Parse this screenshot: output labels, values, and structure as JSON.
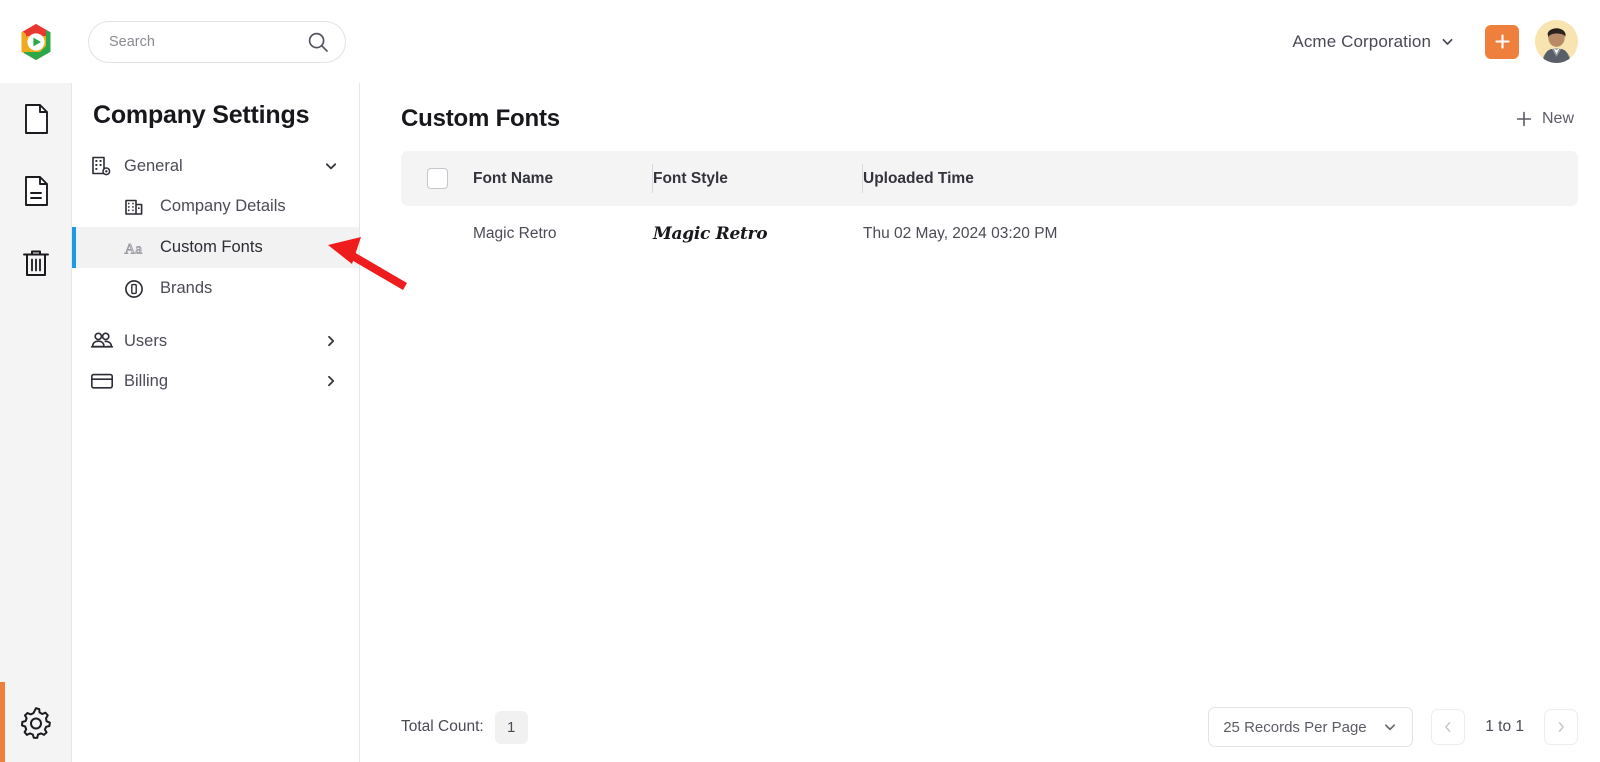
{
  "topbar": {
    "logo_icon": "hexagon-play-logo",
    "search": {
      "placeholder": "Search",
      "value": "",
      "icon": "search-icon"
    },
    "org_name": "Acme Corporation",
    "org_chevron_icon": "chevron-down-icon",
    "add_button_icon": "plus-icon",
    "avatar_icon": "user-avatar"
  },
  "rail": {
    "items": [
      {
        "icon": "file-blank-icon",
        "name": "file-blank"
      },
      {
        "icon": "file-lines-icon",
        "name": "file-lines"
      },
      {
        "icon": "trash-icon",
        "name": "trash"
      }
    ],
    "bottom": {
      "icon": "gear-icon",
      "name": "settings",
      "accent": "#ef7f3c"
    }
  },
  "sidebar": {
    "title": "Company Settings",
    "groups": [
      {
        "label": "General",
        "icon": "building-gear-icon",
        "chevron": "chevron-down-icon",
        "expanded": true,
        "children": [
          {
            "label": "Company Details",
            "icon": "building-icon",
            "active": false
          },
          {
            "label": "Custom Fonts",
            "icon": "font-aa-icon",
            "active": true
          },
          {
            "label": "Brands",
            "icon": "circle-b-icon",
            "active": false
          }
        ]
      },
      {
        "label": "Users",
        "icon": "users-icon",
        "chevron": "chevron-right-icon",
        "expanded": false,
        "children": []
      },
      {
        "label": "Billing",
        "icon": "credit-card-icon",
        "chevron": "chevron-right-icon",
        "expanded": false,
        "children": []
      }
    ],
    "active_indicator_color": "#1c9ae8"
  },
  "main": {
    "page_title": "Custom Fonts",
    "new_button": {
      "label": "New",
      "icon": "plus-icon"
    },
    "table": {
      "select_all_checked": false,
      "columns": [
        "Font Name",
        "Font Style",
        "Uploaded Time"
      ],
      "rows": [
        {
          "font_name": "Magic Retro",
          "font_style": "Magic Retro",
          "uploaded_time": "Thu 02 May, 2024 03:20 PM"
        }
      ]
    }
  },
  "footer": {
    "total_count_label": "Total Count:",
    "total_count_value": "1",
    "records_per_page": "25 Records Per Page",
    "records_chevron_icon": "chevron-down-icon",
    "prev_icon": "chevron-left-icon",
    "next_icon": "chevron-right-icon",
    "page_range": "1 to 1"
  },
  "annotation": {
    "arrow_color": "#ee1c1c",
    "arrow_points_to": "Custom Fonts"
  }
}
